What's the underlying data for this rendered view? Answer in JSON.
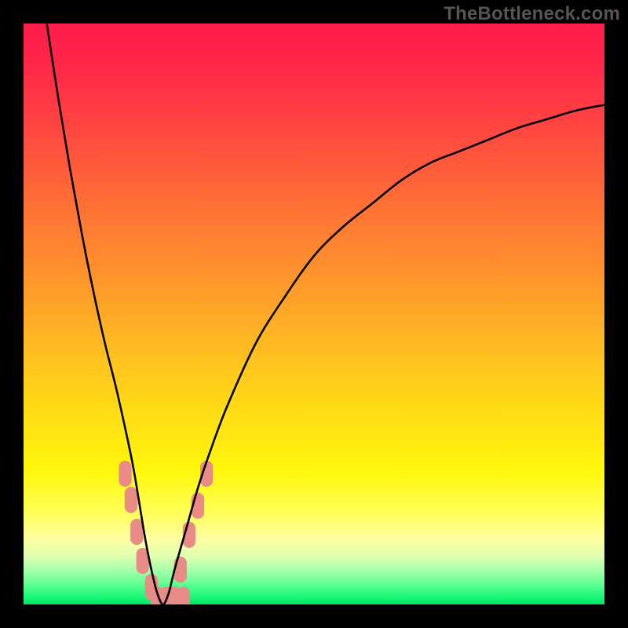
{
  "watermark": "TheBottleneck.com",
  "gradient_stops": [
    {
      "offset": 0.0,
      "color": "#ff1c4b"
    },
    {
      "offset": 0.07,
      "color": "#ff2748"
    },
    {
      "offset": 0.18,
      "color": "#ff4640"
    },
    {
      "offset": 0.3,
      "color": "#ff6c37"
    },
    {
      "offset": 0.43,
      "color": "#ff932d"
    },
    {
      "offset": 0.55,
      "color": "#ffb922"
    },
    {
      "offset": 0.67,
      "color": "#ffdd16"
    },
    {
      "offset": 0.77,
      "color": "#fff70d"
    },
    {
      "offset": 0.84,
      "color": "#ffff55"
    },
    {
      "offset": 0.885,
      "color": "#ffffa0"
    },
    {
      "offset": 0.915,
      "color": "#e4ffb0"
    },
    {
      "offset": 0.94,
      "color": "#a8ffaa"
    },
    {
      "offset": 0.965,
      "color": "#60ff90"
    },
    {
      "offset": 0.985,
      "color": "#20f879"
    },
    {
      "offset": 1.0,
      "color": "#00e765"
    }
  ],
  "chart_data": {
    "type": "line",
    "title": "",
    "xlabel": "",
    "ylabel": "",
    "xlim": [
      0,
      100
    ],
    "ylim": [
      0,
      100
    ],
    "grid": false,
    "legend": false,
    "annotations": [],
    "series": [
      {
        "name": "bottleneck-curve",
        "color": "#000000",
        "x": [
          4,
          6,
          8,
          10,
          12,
          14,
          16,
          18,
          19,
          20,
          21,
          22,
          23,
          24,
          25,
          26,
          28,
          30,
          32,
          35,
          40,
          45,
          50,
          55,
          60,
          65,
          70,
          75,
          80,
          85,
          90,
          95,
          100
        ],
        "y": [
          100,
          87,
          75,
          64,
          54,
          45,
          37,
          28,
          23,
          17,
          11,
          6,
          2,
          0,
          2,
          6,
          13,
          20,
          26,
          34,
          45,
          53,
          60,
          65,
          69,
          73,
          76,
          78,
          80,
          82,
          83.5,
          85,
          86
        ]
      }
    ],
    "markers": {
      "name": "highlight-blobs",
      "color": "#e98b87",
      "shape": "rounded-rect",
      "approx_width": 2.2,
      "approx_height": 4.5,
      "points": [
        {
          "x": 17.5,
          "y": 22.5
        },
        {
          "x": 18.5,
          "y": 18.0
        },
        {
          "x": 19.5,
          "y": 12.5
        },
        {
          "x": 20.5,
          "y": 7.5
        },
        {
          "x": 22.0,
          "y": 3.0
        },
        {
          "x": 23.0,
          "y": 0.8
        },
        {
          "x": 24.5,
          "y": 0.8
        },
        {
          "x": 26.0,
          "y": 0.8
        },
        {
          "x": 27.5,
          "y": 0.8
        },
        {
          "x": 27.0,
          "y": 6.0
        },
        {
          "x": 28.5,
          "y": 12.0
        },
        {
          "x": 30.0,
          "y": 17.0
        },
        {
          "x": 31.5,
          "y": 22.5
        }
      ]
    }
  }
}
